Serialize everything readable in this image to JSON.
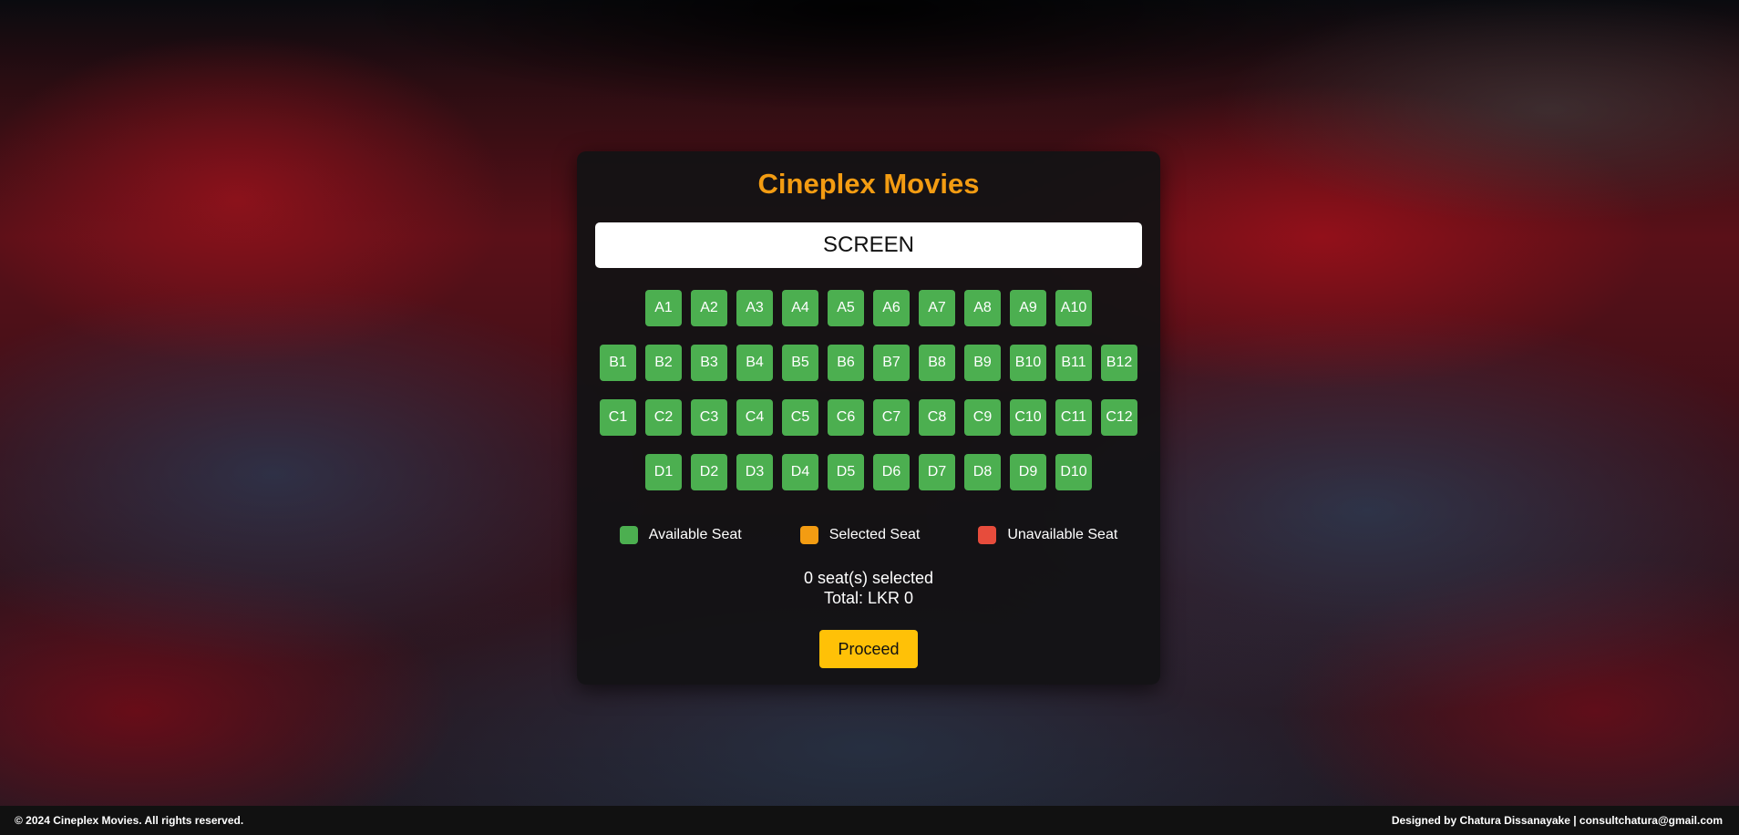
{
  "title": "Cineplex Movies",
  "screen_label": "SCREEN",
  "rows": [
    [
      "A1",
      "A2",
      "A3",
      "A4",
      "A5",
      "A6",
      "A7",
      "A8",
      "A9",
      "A10"
    ],
    [
      "B1",
      "B2",
      "B3",
      "B4",
      "B5",
      "B6",
      "B7",
      "B8",
      "B9",
      "B10",
      "B11",
      "B12"
    ],
    [
      "C1",
      "C2",
      "C3",
      "C4",
      "C5",
      "C6",
      "C7",
      "C8",
      "C9",
      "C10",
      "C11",
      "C12"
    ],
    [
      "D1",
      "D2",
      "D3",
      "D4",
      "D5",
      "D6",
      "D7",
      "D8",
      "D9",
      "D10"
    ]
  ],
  "legend": [
    {
      "label": "Available Seat",
      "color": "#4caf50"
    },
    {
      "label": "Selected Seat",
      "color": "#f39c12"
    },
    {
      "label": "Unavailable Seat",
      "color": "#e74c3c"
    }
  ],
  "selection": {
    "count_text": "0 seat(s) selected",
    "total_text": "Total: LKR 0"
  },
  "proceed_label": "Proceed",
  "footer": {
    "left": "© 2024 Cineplex Movies. All rights reserved.",
    "right": "Designed by Chatura Dissanayake | consultchatura@gmail.com"
  },
  "colors": {
    "accent": "#f39c12",
    "seat_available": "#4caf50",
    "button": "#ffc107"
  }
}
